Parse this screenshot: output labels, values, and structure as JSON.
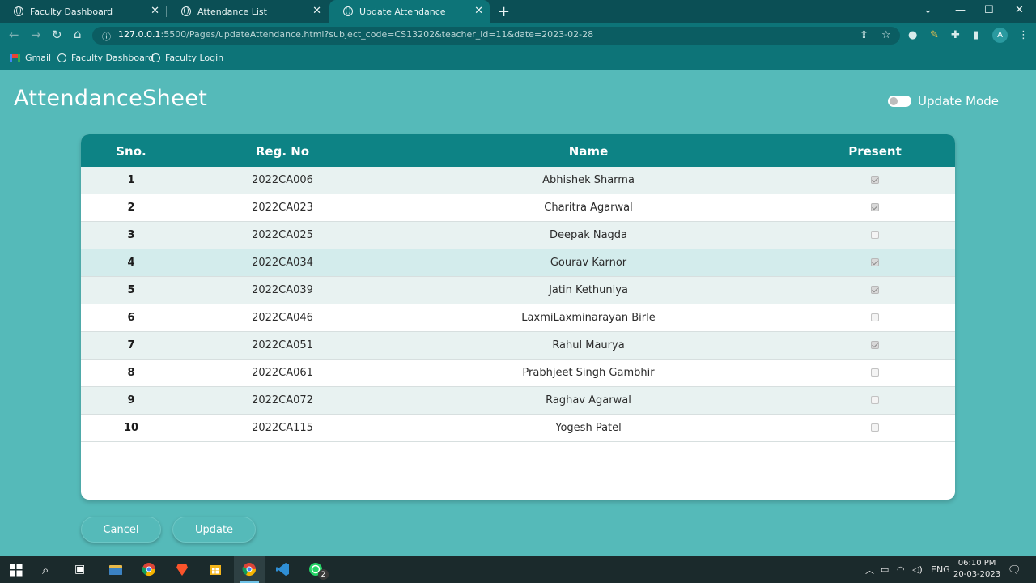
{
  "browser": {
    "tabs": [
      {
        "title": "Faculty Dashboard"
      },
      {
        "title": "Attendance List"
      },
      {
        "title": "Update Attendance"
      }
    ],
    "url_host": "127.0.0.1",
    "url_rest": ":5500/Pages/updateAttendance.html?subject_code=CS13202&teacher_id=11&date=2023-02-28",
    "avatar_letter": "A",
    "bookmarks": [
      "Gmail",
      "Faculty Dashboard",
      "Faculty Login"
    ]
  },
  "page": {
    "title": "AttendanceSheet",
    "toggle_label": "Update Mode",
    "toggle_on": false
  },
  "table": {
    "headers": {
      "sno": "Sno.",
      "reg": "Reg. No",
      "name": "Name",
      "present": "Present"
    },
    "rows": [
      {
        "sno": "1",
        "reg": "2022CA006",
        "name": "Abhishek Sharma",
        "present": true
      },
      {
        "sno": "2",
        "reg": "2022CA023",
        "name": "Charitra Agarwal",
        "present": true
      },
      {
        "sno": "3",
        "reg": "2022CA025",
        "name": "Deepak Nagda",
        "present": false
      },
      {
        "sno": "4",
        "reg": "2022CA034",
        "name": "Gourav Karnor",
        "present": true
      },
      {
        "sno": "5",
        "reg": "2022CA039",
        "name": "Jatin Kethuniya",
        "present": true
      },
      {
        "sno": "6",
        "reg": "2022CA046",
        "name": "LaxmiLaxminarayan Birle",
        "present": false
      },
      {
        "sno": "7",
        "reg": "2022CA051",
        "name": "Rahul Maurya",
        "present": true
      },
      {
        "sno": "8",
        "reg": "2022CA061",
        "name": "Prabhjeet Singh Gambhir",
        "present": false
      },
      {
        "sno": "9",
        "reg": "2022CA072",
        "name": "Raghav Agarwal",
        "present": false
      },
      {
        "sno": "10",
        "reg": "2022CA115",
        "name": "Yogesh Patel",
        "present": false
      }
    ]
  },
  "buttons": {
    "cancel": "Cancel",
    "update": "Update"
  },
  "taskbar": {
    "language": "ENG",
    "time": "06:10 PM",
    "date": "20-03-2023",
    "whatsapp_badge": "2"
  }
}
